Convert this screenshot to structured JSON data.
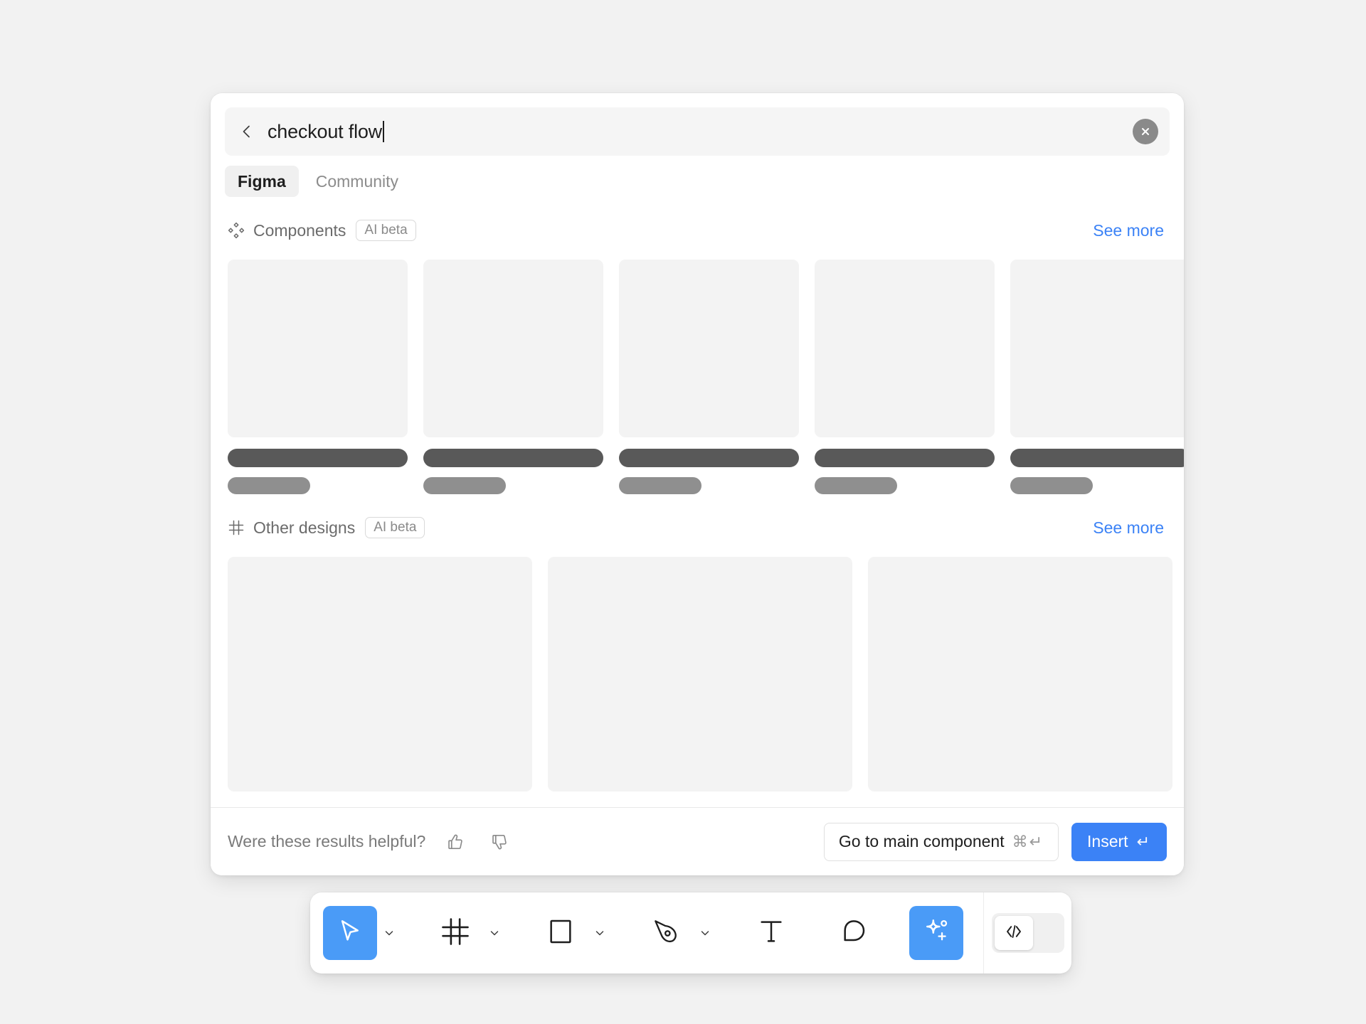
{
  "search": {
    "query": "checkout flow",
    "back_icon": "chevron-left-icon",
    "clear_icon": "close-circle-icon"
  },
  "tabs": [
    {
      "label": "Figma",
      "active": true
    },
    {
      "label": "Community",
      "active": false
    }
  ],
  "sections": [
    {
      "icon": "components-icon",
      "title": "Components",
      "badge": "AI beta",
      "see_more": "See more",
      "cards": [
        {
          "skeleton": true
        },
        {
          "skeleton": true
        },
        {
          "skeleton": true
        },
        {
          "skeleton": true
        },
        {
          "skeleton": true
        }
      ]
    },
    {
      "icon": "frame-icon",
      "title": "Other designs",
      "badge": "AI beta",
      "see_more": "See more",
      "cards": [
        {
          "skeleton": true
        },
        {
          "skeleton": true
        },
        {
          "skeleton": true
        }
      ]
    }
  ],
  "footer": {
    "feedback_question": "Were these results helpful?",
    "thumbs_up_icon": "thumbs-up-icon",
    "thumbs_down_icon": "thumbs-down-icon",
    "secondary_button": {
      "label": "Go to main component",
      "shortcut": "⌘↵"
    },
    "primary_button": {
      "label": "Insert",
      "shortcut": "↵"
    }
  },
  "toolbar": {
    "tools": [
      {
        "name": "move-tool",
        "icon": "cursor-arrow-icon",
        "active": true,
        "has_caret": true
      },
      {
        "name": "frame-tool",
        "icon": "frame-icon",
        "active": false,
        "has_caret": true
      },
      {
        "name": "shape-tool",
        "icon": "square-icon",
        "active": false,
        "has_caret": true
      },
      {
        "name": "pen-tool",
        "icon": "pen-icon",
        "active": false,
        "has_caret": true
      },
      {
        "name": "text-tool",
        "icon": "text-t-icon",
        "active": false,
        "has_caret": false
      },
      {
        "name": "comment-tool",
        "icon": "comment-bubble-icon",
        "active": false,
        "has_caret": false
      },
      {
        "name": "actions-tool",
        "icon": "sparkle-plus-icon",
        "active": true,
        "has_caret": false
      }
    ],
    "dev_mode": {
      "name": "dev-mode-toggle",
      "icon": "code-brackets-icon",
      "enabled": false
    }
  },
  "colors": {
    "accent": "#3b82f6",
    "tool_accent": "#4a9bf7",
    "panel_bg": "#ffffff",
    "page_bg": "#f2f2f2",
    "skeleton_thumb": "#f3f3f3",
    "skeleton_title": "#595959",
    "skeleton_sub": "#8f8f8f"
  }
}
